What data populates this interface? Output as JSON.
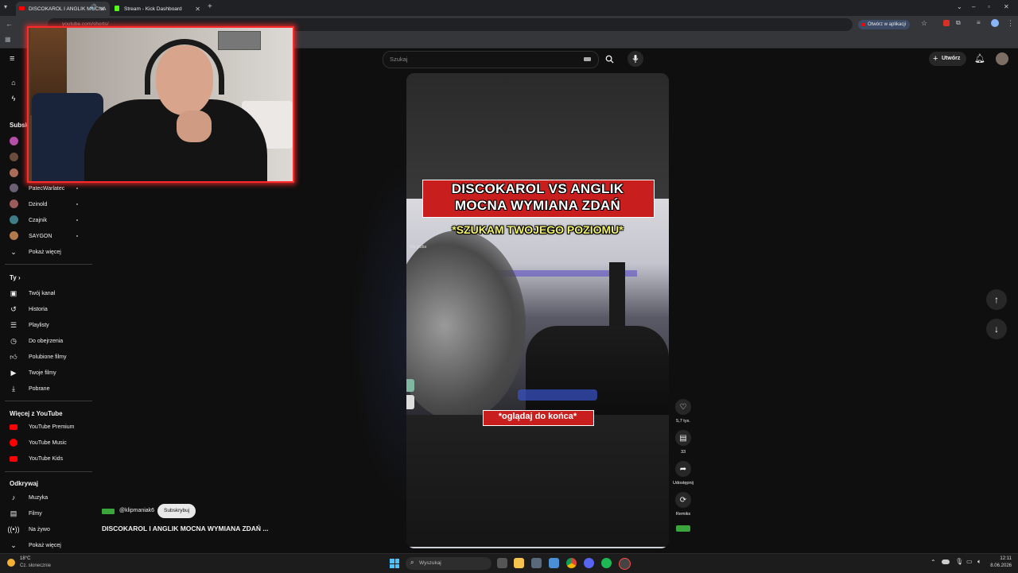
{
  "browser": {
    "tabs": [
      {
        "title": "DISCOKAROL I ANGLIK MOCNA"
      },
      {
        "title": "Stream - Kick Dashboard"
      }
    ],
    "url": "youtube.com/shorts/",
    "open_in_app_label": "Otwórz w aplikacji"
  },
  "youtube": {
    "search_placeholder": "Szukaj",
    "create_label": "Utwórz",
    "subscriptions_heading": "Subskrypcje",
    "subscriptions": [
      {
        "name": "PatecWarlatec",
        "color": "#6b5f74"
      },
      {
        "name": "Dzinold",
        "color": "#9a5b5b"
      },
      {
        "name": "Czajnik",
        "color": "#3f7c86"
      },
      {
        "name": "SAYGON",
        "color": "#b07a4d"
      }
    ],
    "show_more_1": "Pokaż więcej",
    "you_heading": "Ty",
    "you_items": [
      {
        "label": "Twój kanał",
        "icon": "channel-icon"
      },
      {
        "label": "Historia",
        "icon": "history-icon"
      },
      {
        "label": "Playlisty",
        "icon": "playlist-icon"
      },
      {
        "label": "Do obejrzenia",
        "icon": "clock-icon"
      },
      {
        "label": "Polubione filmy",
        "icon": "like-icon"
      },
      {
        "label": "Twoje filmy",
        "icon": "video-icon"
      },
      {
        "label": "Pobrane",
        "icon": "download-icon"
      }
    ],
    "more_heading": "Więcej z YouTube",
    "more_items": [
      {
        "label": "YouTube Premium"
      },
      {
        "label": "YouTube Music"
      },
      {
        "label": "YouTube Kids"
      }
    ],
    "explore_heading": "Odkrywaj",
    "explore_items": [
      {
        "label": "Muzyka",
        "icon": "music-icon"
      },
      {
        "label": "Filmy",
        "icon": "film-icon"
      },
      {
        "label": "Na żywo",
        "icon": "live-icon"
      }
    ],
    "show_more_2": "Pokaż więcej"
  },
  "short": {
    "title_line1": "DISCOKAROL VS ANGLIK",
    "title_line2": "MOCNA WYMIANA ZDAŃ",
    "subtitle": "*SZUKAM TWOJEGO POZIOMU*",
    "caption": "*oglądaj do końca*",
    "small_tag": "Kto głuba",
    "likes": "5,7 tys.",
    "comments": "33",
    "share_label": "Udostępnij",
    "remix_label": "Remiks",
    "channel_handle": "@klipmaniak6",
    "subscribe_label": "Subskrybuj",
    "video_title": "DISCOKAROL I ANGLIK MOCNA WYMIANA ZDAŃ ..."
  },
  "taskbar": {
    "weather_temp": "18°C",
    "weather_desc": "Cz. słonecznie",
    "search_label": "Wyszukaj",
    "time": "12:11",
    "date": "8.06.2026"
  },
  "colors": {
    "accent_red": "#ff2a2a",
    "title_banner_red": "#c81e1e",
    "subtitle_yellow": "#f3f36a"
  }
}
